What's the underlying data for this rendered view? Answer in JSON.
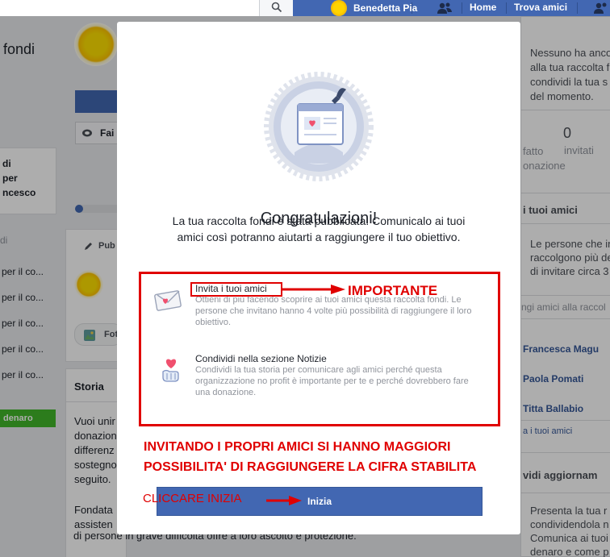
{
  "topbar": {
    "user_name": "Benedetta Pia",
    "home": "Home",
    "find_friends": "Trova amici"
  },
  "left": {
    "title_fragment": "fondi",
    "invite_btn_fragment": "Fai",
    "info_lines": [
      "di",
      "per",
      "ncesco"
    ],
    "links": [
      "per il co...",
      "per il co...",
      "per il co...",
      "per il co...",
      "per il co..."
    ],
    "links_heading": "di",
    "donate_btn": "denaro",
    "publish_tab": "Pub",
    "photo_tab": "Fot",
    "story_heading": "Storia",
    "story_lines": [
      "Vuoi unir",
      "donazion",
      "differenz",
      "sostegno",
      "seguito."
    ],
    "story_more_1": "Fondata",
    "story_more_2": "assisten",
    "story_bottom": "di persone in grave difficoltà offre a loro ascolto e protezione."
  },
  "right": {
    "notice_lines": [
      "Nessuno ha anco",
      "alla tua raccolta f",
      "condividi la tua s",
      "del momento."
    ],
    "stat_value": "0",
    "stat_left_1": "fatto",
    "stat_left_2": "onazione",
    "stat_right": "invitati",
    "friends_heading": "i tuoi amici",
    "friends_text_lines": [
      "Le persone che in",
      "raccolgono più de",
      "di invitare circa 3"
    ],
    "friends_input_placeholder": "ngi amici alla raccol",
    "friends": [
      "Francesca Magu",
      "Paola Pomati",
      "Titta Ballabio"
    ],
    "all_friends_link": "a i tuoi amici",
    "update_heading": "vidi aggiornam",
    "update_lines": [
      "Presenta la tua r",
      "condividendola n",
      "Comunica ai tuoi",
      "denaro e come p"
    ]
  },
  "modal": {
    "title": "Congratulazioni!",
    "description": "La tua raccolta fondi è stata pubblicata. Comunicalo ai tuoi amici così potranno aiutarti a raggiungere il tuo obiettivo.",
    "option1_title": "Invita i tuoi amici",
    "option1_desc": "Ottieni di più facendo scoprire ai tuoi amici questa raccolta fondi. Le persone che invitano hanno 4 volte più possibilità di raggiungere il loro obiettivo.",
    "option2_title": "Condividi nella sezione Notizie",
    "option2_desc": "Condividi la tua storia per comunicare agli amici perché questa organizzazione no profit è importante per te e perché dovrebbero fare una donazione.",
    "start_button": "Inizia"
  },
  "annotations": {
    "importante": "IMPORTANTE",
    "note_line1": "INVITANDO I PROPRI AMICI SI HANNO MAGGIORI",
    "note_line2": "POSSIBILITA' DI RAGGIUNGERE LA CIFRA STABILITA",
    "click_start": "CLICCARE INIZIA"
  },
  "colors": {
    "brand": "#4267b2",
    "annotation": "#e00000",
    "overlay": "rgba(0,0,0,0.32)"
  },
  "icons": [
    "search-icon",
    "friends-icon",
    "envelope-heart-icon",
    "hand-heart-icon",
    "publish-pencil-icon",
    "photo-icon",
    "globe-icon"
  ]
}
